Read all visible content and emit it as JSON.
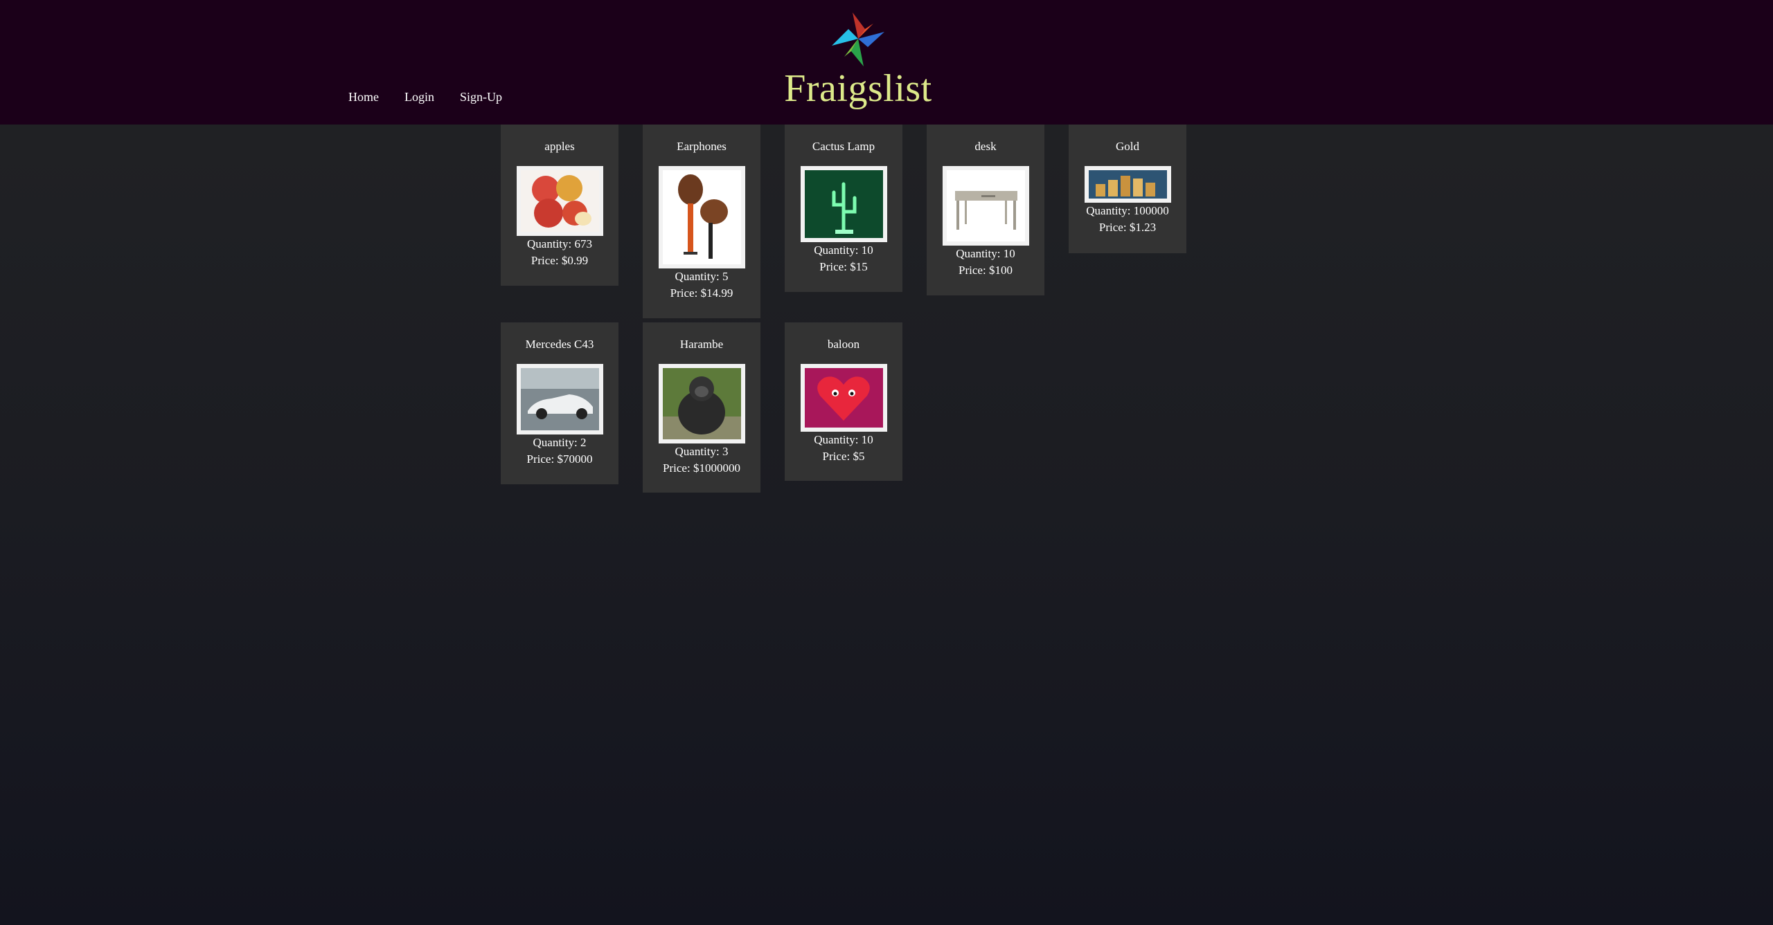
{
  "brand": {
    "name": "Fraigslist",
    "logo": "pinwheel-icon"
  },
  "nav": {
    "home": "Home",
    "login": "Login",
    "signup": "Sign-Up"
  },
  "listings": [
    {
      "title": "apples",
      "quantity": "Quantity: 673",
      "price": "Price: $0.99",
      "image": "apples-photo"
    },
    {
      "title": "Earphones",
      "quantity": "Quantity: 5",
      "price": "Price: $14.99",
      "image": "earphones-photo"
    },
    {
      "title": "Cactus Lamp",
      "quantity": "Quantity: 10",
      "price": "Price: $15",
      "image": "cactus-lamp-photo"
    },
    {
      "title": "desk",
      "quantity": "Quantity: 10",
      "price": "Price: $100",
      "image": "desk-photo"
    },
    {
      "title": "Gold",
      "quantity": "Quantity: 100000",
      "price": "Price: $1.23",
      "image": "gold-coins-photo"
    },
    {
      "title": "Mercedes C43",
      "quantity": "Quantity: 2",
      "price": "Price: $70000",
      "image": "car-photo"
    },
    {
      "title": "Harambe",
      "quantity": "Quantity: 3",
      "price": "Price: $1000000",
      "image": "gorilla-photo"
    },
    {
      "title": "baloon",
      "quantity": "Quantity: 10",
      "price": "Price: $5",
      "image": "heart-balloon-photo"
    }
  ],
  "colors": {
    "header": "#1b0019",
    "card": "#333333",
    "logo_text": "#dde98a"
  }
}
